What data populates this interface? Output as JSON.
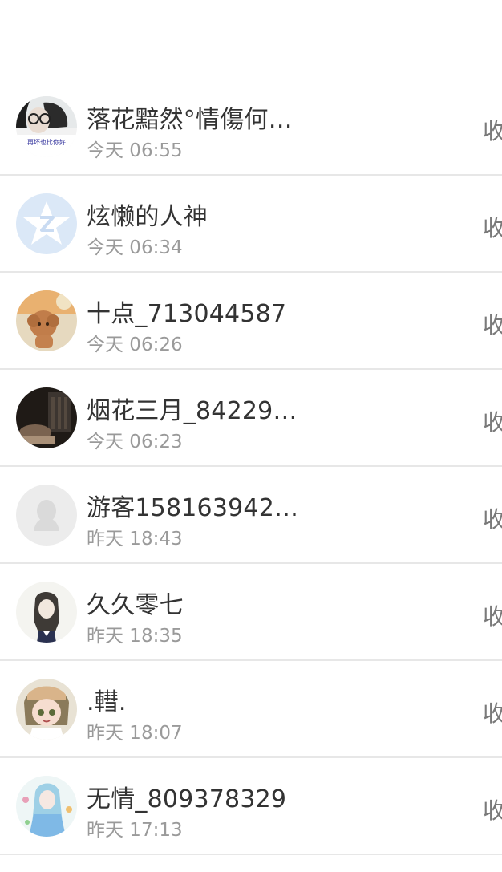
{
  "list": {
    "items": [
      {
        "name": "落花黯然°情傷何…",
        "time": "今天 06:55",
        "action": "收",
        "avatar_text": "再坏也比你好"
      },
      {
        "name": "炫懒的人神",
        "time": "今天 06:34",
        "action": "收"
      },
      {
        "name": "十点_713044587",
        "time": "今天 06:26",
        "action": "收"
      },
      {
        "name": "烟花三月_84229…",
        "time": "今天 06:23",
        "action": "收"
      },
      {
        "name": "游客158163942…",
        "time": "昨天 18:43",
        "action": "收"
      },
      {
        "name": "久久零七",
        "time": "昨天 18:35",
        "action": "收"
      },
      {
        "name": ".轊.",
        "time": "昨天 18:07",
        "action": "收"
      },
      {
        "name": "无情_809378329",
        "time": "昨天 17:13",
        "action": "收"
      }
    ]
  },
  "colors": {
    "divider": "#e7e7e7",
    "name_text": "#333333",
    "time_text": "#9a9a9a",
    "qq_avatar_bg": "#dbe8f7",
    "default_avatar_bg": "#ececec"
  }
}
